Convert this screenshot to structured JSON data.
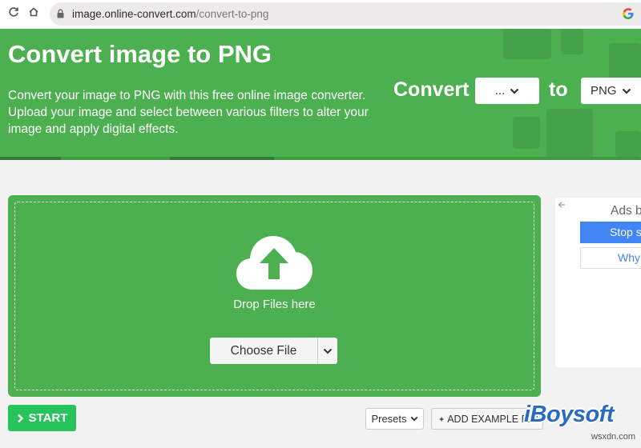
{
  "browser": {
    "back_icon": "reload-icon",
    "url_host": "image.online-convert.com",
    "url_path": "/convert-to-png"
  },
  "hero": {
    "title": "Convert image to PNG",
    "description": "Convert your image to PNG with this free online image converter. Upload your image and select between various filters to alter your image and apply digital effects.",
    "convert_label": "Convert",
    "from_value": "...",
    "to_label": "to",
    "to_value": "PNG"
  },
  "dropzone": {
    "icon": "cloud-upload-icon",
    "drop_text": "Drop Files here",
    "choose_file_label": "Choose File"
  },
  "ads": {
    "title": "Ads b",
    "stop_label": "Stop s",
    "why_label": "Why"
  },
  "controls": {
    "start_label": "START",
    "presets_label": "Presets",
    "add_example_label": "ADD EXAMPLE FILE"
  },
  "watermark": {
    "brand": "iBoysoft",
    "site": "wsxdn.com"
  },
  "colors": {
    "accent_green": "#4caf50",
    "start_green": "#27c35b",
    "ads_blue": "#4285f4"
  }
}
